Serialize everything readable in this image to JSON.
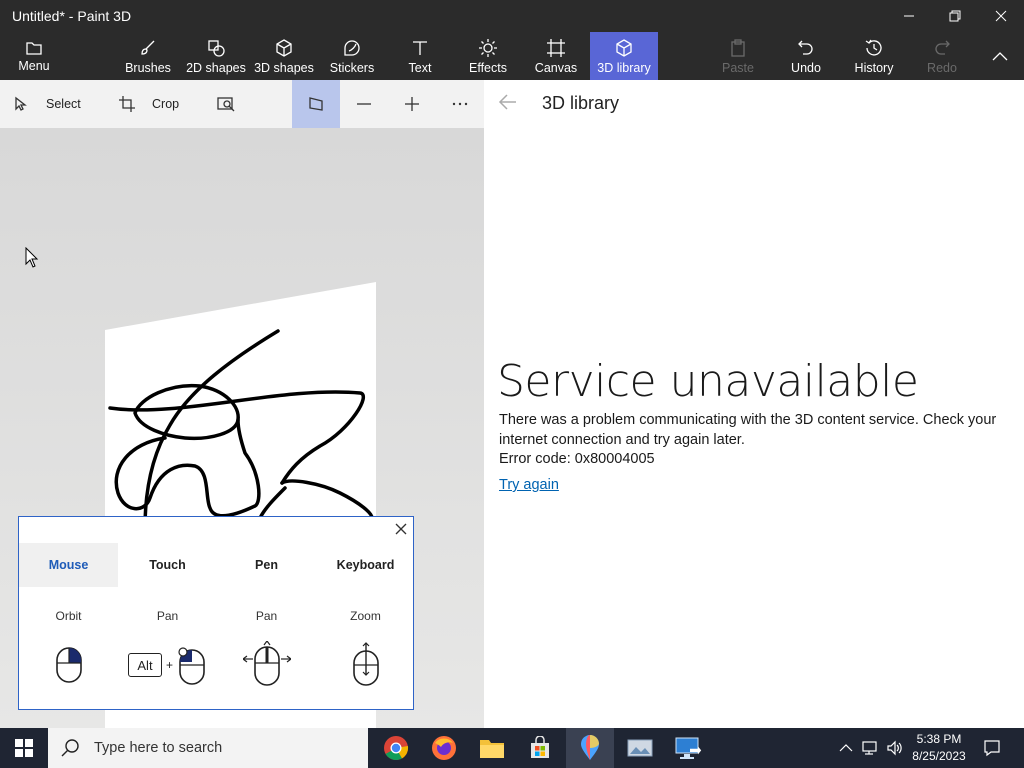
{
  "window": {
    "title": "Untitled* - Paint 3D",
    "controls": [
      "minimize-icon",
      "restore-icon",
      "close-icon"
    ]
  },
  "ribbon": {
    "menu": "Menu",
    "brushes": "Brushes",
    "shapes2d": "2D shapes",
    "shapes3d": "3D shapes",
    "stickers": "Stickers",
    "text": "Text",
    "effects": "Effects",
    "canvas": "Canvas",
    "library3d": "3D library",
    "paste": "Paste",
    "undo": "Undo",
    "history": "History",
    "redo": "Redo",
    "colors": {
      "bar": "#2b2b2b",
      "active": "#5966d6"
    }
  },
  "toolbar": {
    "select": "Select",
    "crop": "Crop"
  },
  "library_panel": {
    "title": "3D library",
    "error_title": "Service unavailable",
    "error_message": "There was a problem communicating with the 3D content service. Check your internet connection and try again later.",
    "error_code": "Error code: 0x80004005",
    "retry_link": "Try again"
  },
  "help_dialog": {
    "tabs": [
      "Mouse",
      "Touch",
      "Pen",
      "Keyboard"
    ],
    "active_tab": "Mouse",
    "labels": [
      "Orbit",
      "Pan",
      "Pan",
      "Zoom"
    ],
    "alt_key": "Alt",
    "plus": "+"
  },
  "taskbar": {
    "search_placeholder": "Type here to search",
    "apps": [
      "chrome-icon",
      "firefox-icon",
      "file-explorer-icon",
      "store-icon",
      "paint3d-icon",
      "photos-icon",
      "remote-desktop-icon"
    ],
    "time": "5:38 PM",
    "date": "8/25/2023"
  }
}
